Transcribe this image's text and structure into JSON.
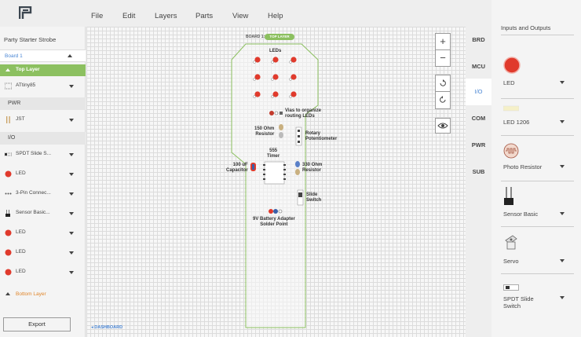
{
  "menu": [
    "File",
    "Edit",
    "Layers",
    "Parts",
    "View",
    "Help"
  ],
  "sidebar": {
    "project_title": "Party Starter Strobe",
    "board": "Board 1",
    "top_layer": "Top Layer",
    "items": [
      {
        "label": "ATtiny85",
        "icon": "chip-icon"
      },
      {
        "section": "PWR"
      },
      {
        "label": "JST",
        "icon": "connector-icon"
      },
      {
        "section": "I/O"
      },
      {
        "label": "SPDT Slide S...",
        "icon": "switch-icon"
      },
      {
        "label": "LED",
        "icon": "led-icon"
      },
      {
        "label": "3-Pin Connec...",
        "icon": "pin-icon"
      },
      {
        "label": "Sensor Basic...",
        "icon": "sensor-icon"
      },
      {
        "label": "LED",
        "icon": "led-icon"
      },
      {
        "label": "LED",
        "icon": "led-icon"
      },
      {
        "label": "LED",
        "icon": "led-icon"
      }
    ],
    "bottom_layer": "Bottom Layer",
    "export_label": "Export"
  },
  "canvas": {
    "board_label": "BOARD 1:",
    "layer_pill": "TOP LAYER",
    "labels": {
      "leds": "LEDs",
      "vias": "Vias to organize\nrouting LEDs",
      "res150": "150 Ohm\nResistor",
      "pot": "Rotary\nPotentiometer",
      "timer": "555\nTimer",
      "cap": "100 uF\nCapacitor",
      "res330": "330 Ohm\nResistor",
      "slide": "Slide\nSwitch",
      "battery": "9V Battery Adapter\nSolder Point"
    },
    "zoom_in": "+",
    "zoom_out": "−",
    "dashboard": "DASHBOARD"
  },
  "tabs": [
    {
      "label": "BRD",
      "active": false
    },
    {
      "label": "MCU",
      "active": false
    },
    {
      "label": "I/O",
      "active": true
    },
    {
      "label": "COM",
      "active": false
    },
    {
      "label": "PWR",
      "active": false
    },
    {
      "label": "SUB",
      "active": false
    }
  ],
  "parts_panel": {
    "title": "Inputs and Outputs",
    "parts": [
      {
        "label": "LED",
        "icon": "led-red-icon"
      },
      {
        "label": "LED 1206",
        "icon": "led-smd-icon"
      },
      {
        "label": "Photo Resistor",
        "icon": "photo-resistor-icon"
      },
      {
        "label": "Sensor Basic",
        "icon": "sensor-icon"
      },
      {
        "label": "Servo",
        "icon": "servo-icon"
      },
      {
        "label": "SPDT Slide\nSwitch",
        "icon": "slide-switch-icon"
      }
    ]
  },
  "colors": {
    "accent": "#4a86d4",
    "layer_green": "#8cc060",
    "bottom_orange": "#e0862b",
    "led_red": "#e03a2c"
  }
}
